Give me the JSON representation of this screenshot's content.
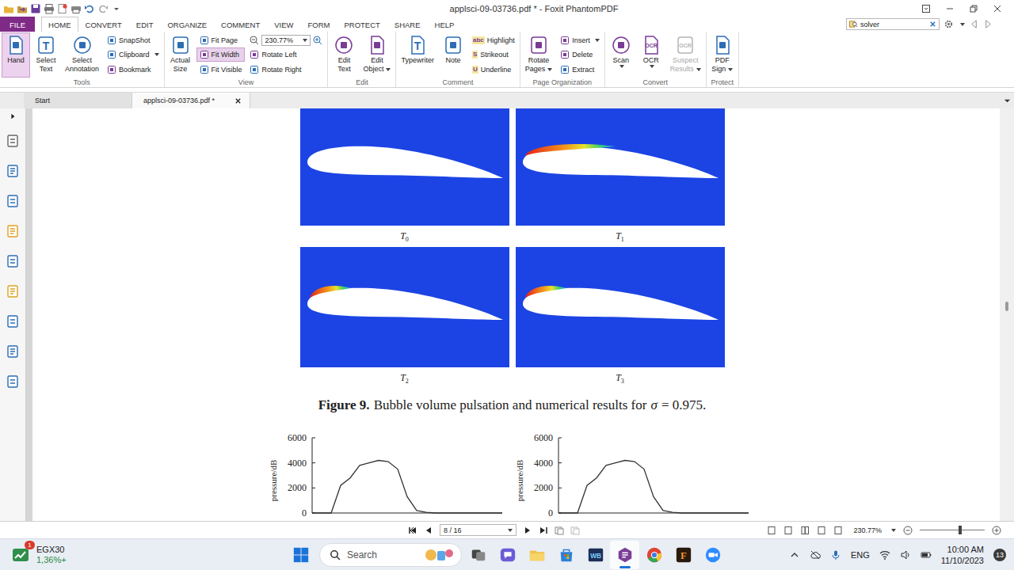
{
  "window": {
    "title": "applsci-09-03736.pdf * - Foxit PhantomPDF"
  },
  "search": {
    "value": "solver"
  },
  "menu_tabs": [
    {
      "label": "FILE",
      "selected": false,
      "kind": "file"
    },
    {
      "label": "HOME",
      "selected": true,
      "kind": "tab"
    },
    {
      "label": "CONVERT",
      "selected": false,
      "kind": "tab"
    },
    {
      "label": "EDIT",
      "selected": false,
      "kind": "tab"
    },
    {
      "label": "ORGANIZE",
      "selected": false,
      "kind": "tab"
    },
    {
      "label": "COMMENT",
      "selected": false,
      "kind": "tab"
    },
    {
      "label": "VIEW",
      "selected": false,
      "kind": "tab"
    },
    {
      "label": "FORM",
      "selected": false,
      "kind": "tab"
    },
    {
      "label": "PROTECT",
      "selected": false,
      "kind": "tab"
    },
    {
      "label": "SHARE",
      "selected": false,
      "kind": "tab"
    },
    {
      "label": "HELP",
      "selected": false,
      "kind": "tab"
    }
  ],
  "ribbon": [
    {
      "label": "Tools",
      "columns": [
        {
          "kind": "large",
          "lines": [
            "Hand"
          ],
          "selected": true,
          "disabled": false,
          "dropdown": false
        },
        {
          "kind": "large",
          "lines": [
            "Select",
            "Text"
          ],
          "selected": false,
          "disabled": false,
          "dropdown": false,
          "glyph": "T"
        },
        {
          "kind": "large",
          "lines": [
            "Select",
            "Annotation"
          ],
          "selected": false,
          "disabled": false,
          "dropdown": false
        },
        {
          "kind": "stack",
          "items": [
            {
              "kind": "small",
              "label": "SnapShot",
              "selected": false,
              "disabled": false,
              "dropdown": false
            },
            {
              "kind": "small",
              "label": "Clipboard",
              "selected": false,
              "disabled": false,
              "dropdown": true
            },
            {
              "kind": "small",
              "label": "Bookmark",
              "selected": false,
              "disabled": false,
              "dropdown": false
            }
          ]
        }
      ]
    },
    {
      "label": "View",
      "columns": [
        {
          "kind": "large",
          "lines": [
            "Actual",
            "Size"
          ],
          "selected": false,
          "disabled": false,
          "dropdown": false
        },
        {
          "kind": "stack",
          "items": [
            {
              "kind": "small",
              "label": "Fit Page",
              "selected": false,
              "disabled": false,
              "dropdown": false
            },
            {
              "kind": "small",
              "label": "Fit Width",
              "selected": true,
              "disabled": false,
              "dropdown": false
            },
            {
              "kind": "small",
              "label": "Fit Visible",
              "selected": false,
              "disabled": false,
              "dropdown": false
            }
          ]
        },
        {
          "kind": "stack",
          "items": [
            {
              "kind": "zoom",
              "label": "230.77%",
              "selected": false,
              "disabled": false,
              "dropdown": true
            },
            {
              "kind": "small",
              "label": "Rotate Left",
              "selected": false,
              "disabled": false,
              "dropdown": false
            },
            {
              "kind": "small",
              "label": "Rotate Right",
              "selected": false,
              "disabled": false,
              "dropdown": false
            }
          ]
        }
      ]
    },
    {
      "label": "Edit",
      "columns": [
        {
          "kind": "large",
          "lines": [
            "Edit",
            "Text"
          ],
          "selected": false,
          "disabled": false,
          "dropdown": false
        },
        {
          "kind": "large",
          "lines": [
            "Edit",
            "Object"
          ],
          "selected": false,
          "disabled": false,
          "dropdown": true
        }
      ]
    },
    {
      "label": "Comment",
      "columns": [
        {
          "kind": "large",
          "lines": [
            "Typewriter"
          ],
          "selected": false,
          "disabled": false,
          "dropdown": false,
          "glyph": "T"
        },
        {
          "kind": "large",
          "lines": [
            "Note"
          ],
          "selected": false,
          "disabled": false,
          "dropdown": false
        },
        {
          "kind": "stack",
          "items": [
            {
              "kind": "small",
              "label": "Highlight",
              "selected": false,
              "disabled": false,
              "dropdown": false,
              "glyph": "abc"
            },
            {
              "kind": "small",
              "label": "Strikeout",
              "selected": false,
              "disabled": false,
              "dropdown": false,
              "glyph": "S"
            },
            {
              "kind": "small",
              "label": "Underline",
              "selected": false,
              "disabled": false,
              "dropdown": false,
              "glyph": "U"
            }
          ]
        }
      ]
    },
    {
      "label": "Page Organization",
      "columns": [
        {
          "kind": "large",
          "lines": [
            "Rotate",
            "Pages"
          ],
          "selected": false,
          "disabled": false,
          "dropdown": true
        },
        {
          "kind": "stack",
          "items": [
            {
              "kind": "small",
              "label": "Insert",
              "selected": false,
              "disabled": false,
              "dropdown": true
            },
            {
              "kind": "small",
              "label": "Delete",
              "selected": false,
              "disabled": false,
              "dropdown": false
            },
            {
              "kind": "small",
              "label": "Extract",
              "selected": false,
              "disabled": false,
              "dropdown": false
            }
          ]
        }
      ]
    },
    {
      "label": "Convert",
      "columns": [
        {
          "kind": "large",
          "lines": [
            "Scan"
          ],
          "selected": false,
          "disabled": false,
          "dropdown": true
        },
        {
          "kind": "large",
          "lines": [
            "OCR"
          ],
          "selected": false,
          "disabled": false,
          "dropdown": true,
          "glyph": "OCR"
        },
        {
          "kind": "large",
          "lines": [
            "Suspect",
            "Results"
          ],
          "selected": false,
          "disabled": true,
          "dropdown": true,
          "glyph": "OCR"
        }
      ]
    },
    {
      "label": "Protect",
      "columns": [
        {
          "kind": "large",
          "lines": [
            "PDF",
            "Sign"
          ],
          "selected": false,
          "disabled": false,
          "dropdown": true
        }
      ]
    }
  ],
  "doc_tabs": [
    {
      "label": "Start",
      "selected": false,
      "closable": false
    },
    {
      "label": "applsci-09-03736.pdf *",
      "selected": true,
      "closable": true
    }
  ],
  "page_view": {
    "scroll_level": 0.48
  },
  "figure": {
    "panels": [
      {
        "symbol": "T",
        "sub": "0",
        "level": 0
      },
      {
        "symbol": "T",
        "sub": "1",
        "level": 0.45
      },
      {
        "symbol": "T",
        "sub": "2",
        "level": 0.2
      },
      {
        "symbol": "T",
        "sub": "3",
        "level": 0.2
      }
    ],
    "caption": {
      "label": "Figure 9.",
      "text": "Bubble volume pulsation and numerical results for",
      "symbol": "σ",
      "value": "= 0.975."
    }
  },
  "charts": [
    {
      "y_label": "pressure/dB",
      "y_ticks": [
        "6000",
        "4000",
        "2000",
        "0"
      ],
      "values": [
        0,
        0,
        0,
        2200,
        2800,
        3800,
        4000,
        4200,
        4100,
        3500,
        1300,
        200,
        50,
        0,
        0,
        0,
        0,
        0,
        0,
        0,
        0
      ]
    },
    {
      "y_label": "pressure/dB",
      "y_ticks": [
        "6000",
        "4000",
        "2000",
        "0"
      ],
      "values": [
        0,
        0,
        0,
        2200,
        2800,
        3800,
        4000,
        4200,
        4100,
        3500,
        1300,
        200,
        50,
        0,
        0,
        0,
        0,
        0,
        0,
        0,
        0
      ]
    }
  ],
  "status_bar": {
    "page": "8 / 16",
    "zoom": "230.77%",
    "level": 0.63
  },
  "taskbar": {
    "ticker": {
      "name": "EGX30",
      "change": "1,36%+",
      "badge": "1"
    },
    "search": "Search",
    "apps": [
      {
        "selected": false
      },
      {
        "selected": false
      },
      {
        "selected": false
      },
      {
        "selected": false
      },
      {
        "selected": false,
        "glyph": "WB"
      },
      {
        "selected": true
      },
      {
        "selected": false
      },
      {
        "selected": false,
        "glyph": "F"
      },
      {
        "selected": false
      }
    ],
    "lang": "ENG",
    "time": "10:00 AM",
    "date": "11/10/2023",
    "notifications": "13"
  }
}
